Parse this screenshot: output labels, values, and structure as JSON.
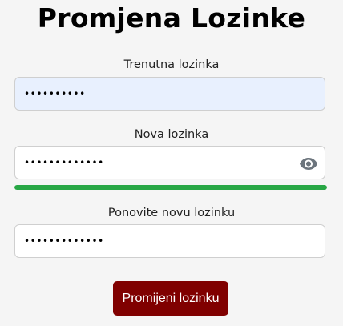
{
  "page": {
    "title": "Promjena Lozinke"
  },
  "form": {
    "current_password": {
      "label": "Trenutna lozinka",
      "value": "••••••••••"
    },
    "new_password": {
      "label": "Nova lozinka",
      "value": "•••••••••••••",
      "toggle_icon": "eye-icon",
      "strength_fraction": 1.0,
      "strength_color": "#28a745"
    },
    "repeat_password": {
      "label": "Ponovite novu lozinku",
      "value": "•••••••••••••"
    },
    "submit_label": "Promijeni lozinku"
  },
  "colors": {
    "accent": "#800000",
    "autofill_background": "#e8f0fe",
    "strength": "#28a745"
  }
}
